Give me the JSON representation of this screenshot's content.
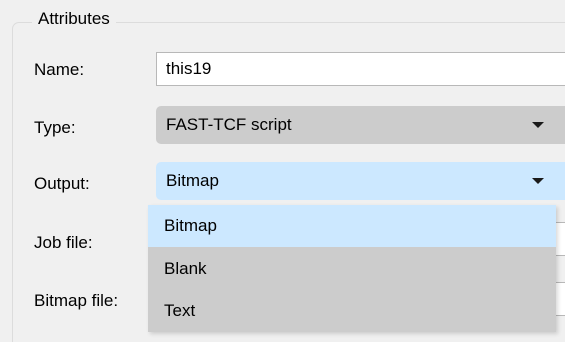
{
  "groupbox": {
    "legend": "Attributes"
  },
  "fields": {
    "name": {
      "label": "Name:",
      "value": "this19"
    },
    "type": {
      "label": "Type:",
      "value": "FAST-TCF script"
    },
    "output": {
      "label": "Output:",
      "value": "Bitmap"
    },
    "job_file": {
      "label": "Job file:"
    },
    "bitmap_file": {
      "label": "Bitmap file:"
    }
  },
  "output_dropdown": {
    "options": [
      "Bitmap",
      "Blank",
      "Text"
    ],
    "selected": "Bitmap"
  },
  "colors": {
    "window_bg": "#f0f0f0",
    "combo_readonly_bg": "#cccccc",
    "combo_active_bg": "#cce8ff",
    "dropdown_bg": "#cccccc",
    "option_highlight": "#cce8ff"
  },
  "icons": {
    "combo_arrow": "chevron-down-icon"
  }
}
